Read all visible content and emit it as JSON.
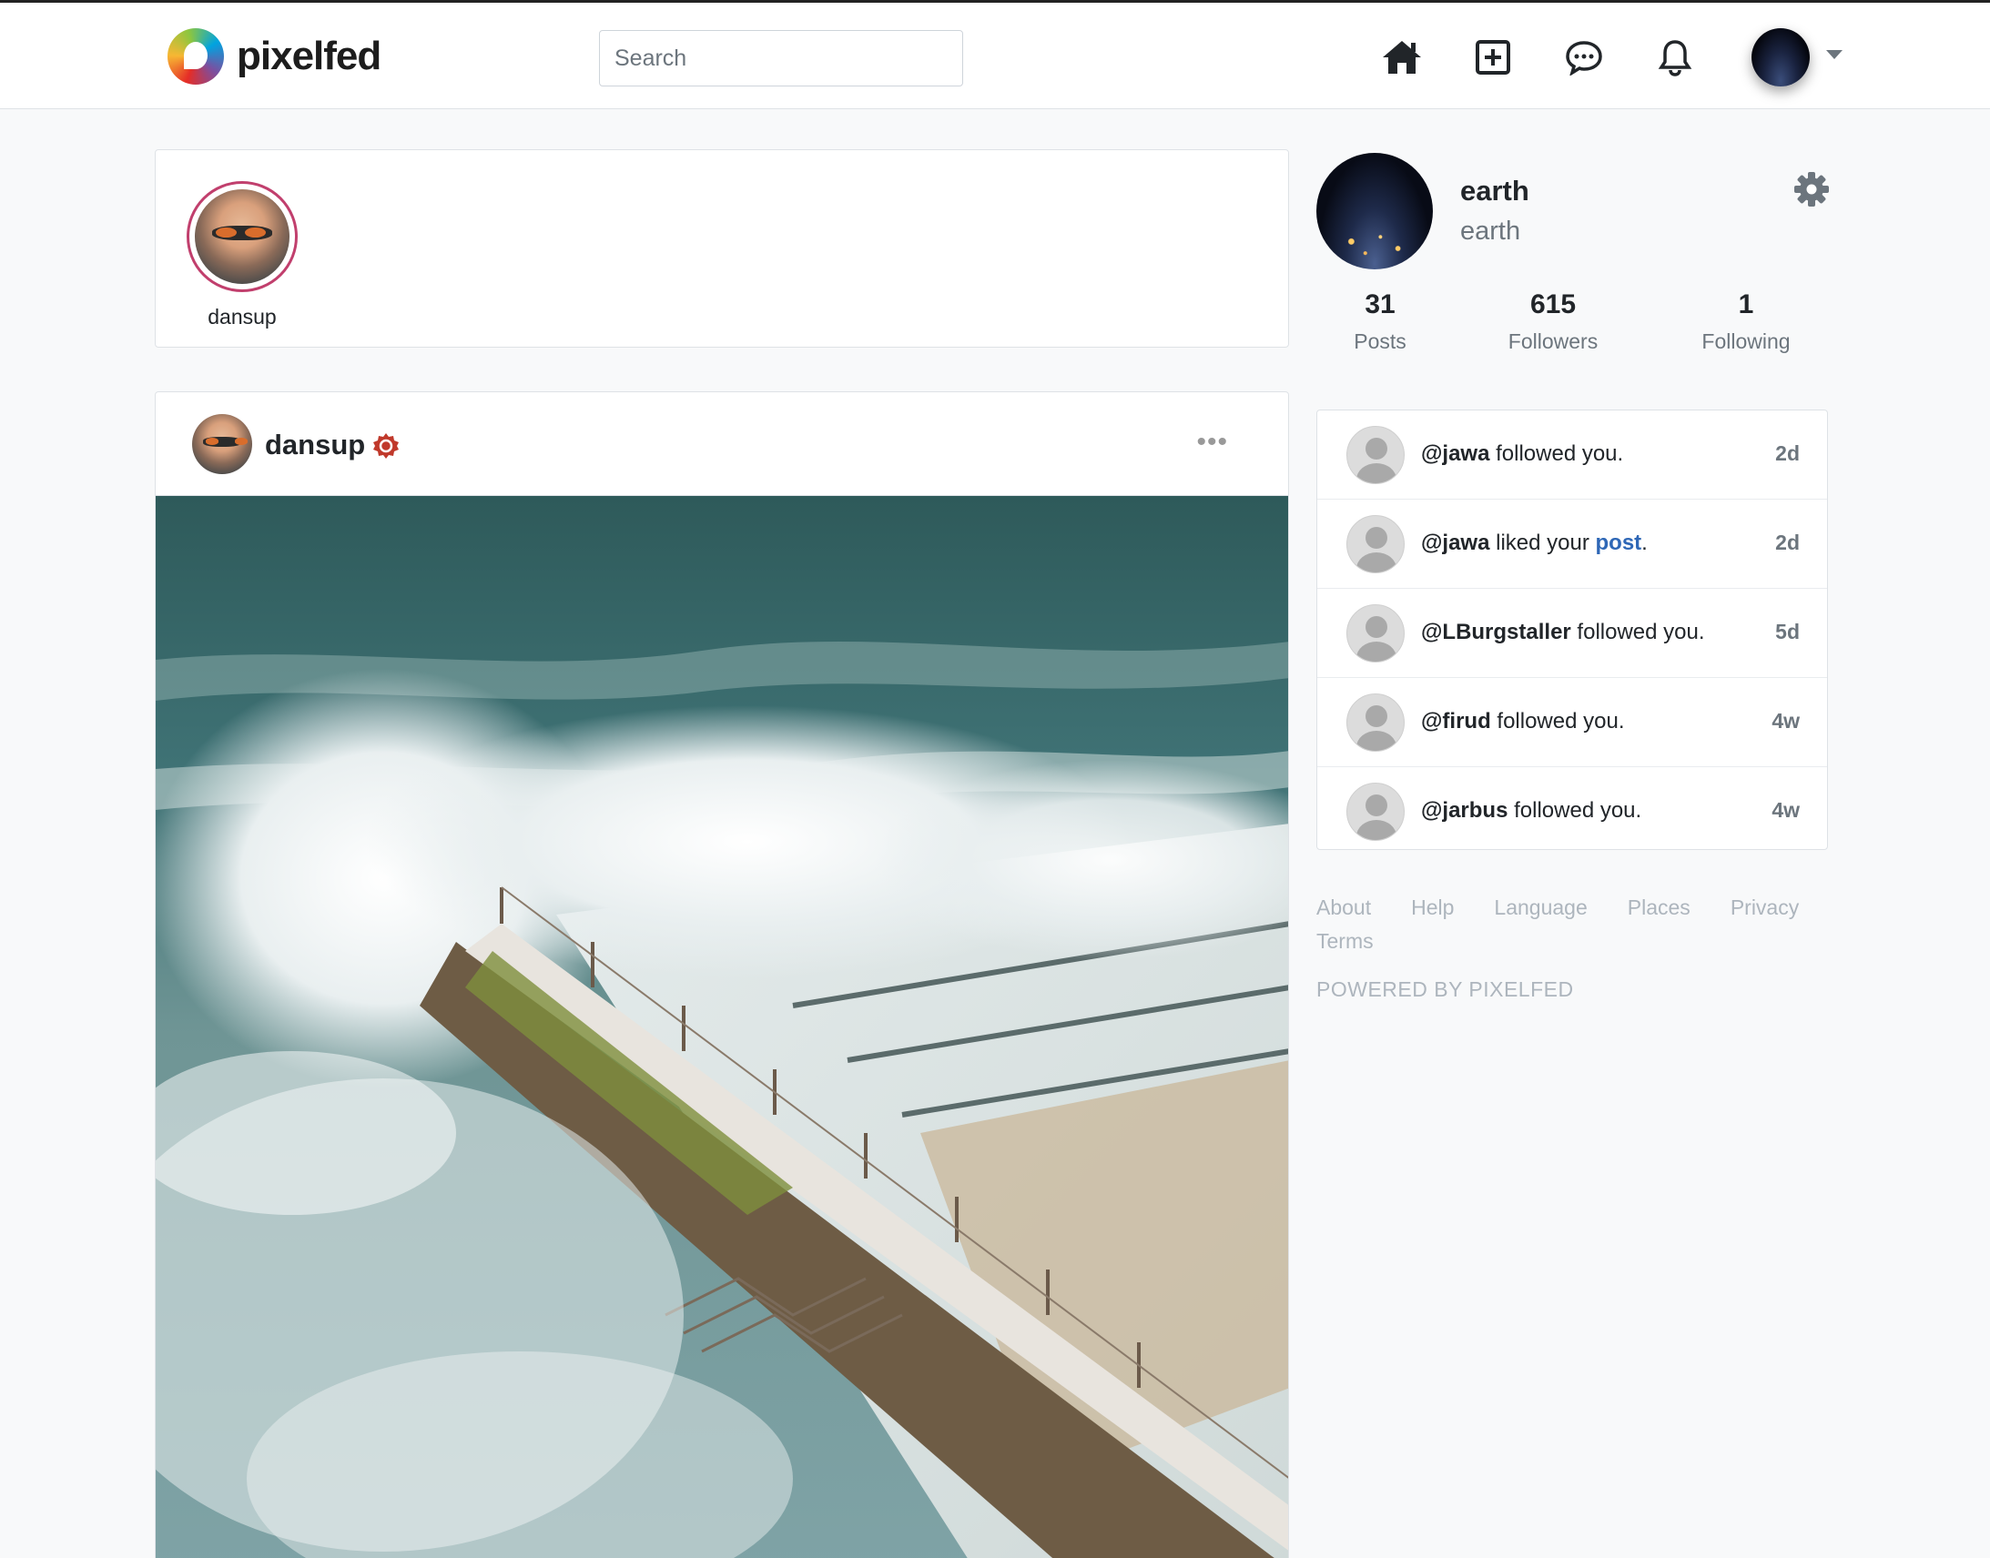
{
  "header": {
    "brand": "pixelfed",
    "search_placeholder": "Search",
    "icons": [
      "home-icon",
      "add-post-icon",
      "messages-icon",
      "notifications-icon"
    ]
  },
  "stories": [
    {
      "username": "dansup"
    }
  ],
  "post": {
    "author": "dansup",
    "badge_color": "#c0392b",
    "menu": "•••"
  },
  "profile": {
    "name": "earth",
    "handle": "earth",
    "stats": [
      {
        "value": "31",
        "label": "Posts"
      },
      {
        "value": "615",
        "label": "Followers"
      },
      {
        "value": "1",
        "label": "Following"
      }
    ]
  },
  "notifications": [
    {
      "user": "@jawa",
      "text": " followed you.",
      "link": "",
      "after": "",
      "time": "2d"
    },
    {
      "user": "@jawa",
      "text": " liked your ",
      "link": "post",
      "after": ".",
      "time": "2d"
    },
    {
      "user": "@LBurgstaller",
      "text": " followed you.",
      "link": "",
      "after": "",
      "time": "5d"
    },
    {
      "user": "@firud",
      "text": " followed you.",
      "link": "",
      "after": "",
      "time": "4w"
    },
    {
      "user": "@jarbus",
      "text": " followed you.",
      "link": "",
      "after": "",
      "time": "4w"
    }
  ],
  "footer": {
    "links": [
      "About",
      "Help",
      "Language",
      "Places",
      "Privacy",
      "Terms"
    ],
    "powered": "POWERED BY PIXELFED"
  },
  "colors": {
    "accent_link": "#2e67b6",
    "story_ring": "#c13f6d"
  }
}
